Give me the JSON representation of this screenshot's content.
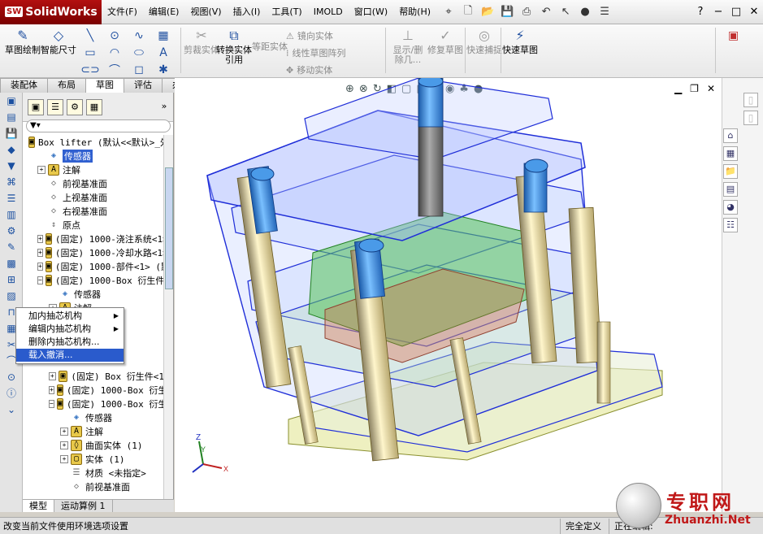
{
  "app": {
    "name": "SolidWorks",
    "logo_prefix": "SW"
  },
  "menu": [
    "文件(F)",
    "编辑(E)",
    "视图(V)",
    "插入(I)",
    "工具(T)",
    "IMOLD",
    "窗口(W)",
    "帮助(H)"
  ],
  "window_controls": {
    "help": "?",
    "minimize": "−",
    "restore": "□",
    "close": "✕"
  },
  "command_manager": {
    "sketch": "草图绘制",
    "smart_dim": "智能尺寸",
    "trim": "剪裁实体",
    "convert": "转换实体引用",
    "offset": "等距实体",
    "mirror": "镜向实体",
    "linear_pattern": "线性草图阵列",
    "move": "移动实体",
    "show_hide": "显示/删除几...",
    "repair": "修复草图",
    "snap": "快速捕捉",
    "rapid_sketch": "快速草图"
  },
  "tabs": [
    "装配体",
    "布局",
    "草图",
    "评估",
    "办公室产品"
  ],
  "active_tab": "草图",
  "tree": [
    {
      "label": "Box lifter  (默认<<默认>_外",
      "indent": 0,
      "exp": "",
      "icon": "asm"
    },
    {
      "label": "传感器",
      "indent": 1,
      "exp": "",
      "icon": "sensor",
      "selected": true
    },
    {
      "label": "注解",
      "indent": 1,
      "exp": "+",
      "icon": "A"
    },
    {
      "label": "前视基准面",
      "indent": 1,
      "exp": "",
      "icon": "plane"
    },
    {
      "label": "上视基准面",
      "indent": 1,
      "exp": "",
      "icon": "plane"
    },
    {
      "label": "右视基准面",
      "indent": 1,
      "exp": "",
      "icon": "plane"
    },
    {
      "label": "原点",
      "indent": 1,
      "exp": "",
      "icon": "origin"
    },
    {
      "label": "(固定) 1000-浇注系统<1>",
      "indent": 1,
      "exp": "+",
      "icon": "asm"
    },
    {
      "label": "(固定) 1000-冷却水路<1>",
      "indent": 1,
      "exp": "+",
      "icon": "asm"
    },
    {
      "label": "(固定) 1000-部件<1> (默",
      "indent": 1,
      "exp": "+",
      "icon": "asm"
    },
    {
      "label": "(固定) 1000-Box 衍生件_",
      "indent": 1,
      "exp": "−",
      "icon": "asm"
    },
    {
      "label": "传感器",
      "indent": 2,
      "exp": "",
      "icon": "sensor"
    },
    {
      "label": "注解",
      "indent": 2,
      "exp": "+",
      "icon": "A"
    }
  ],
  "tree_lower": [
    {
      "label": "(固定) Box 衍生件<1",
      "indent": 2,
      "exp": "+",
      "icon": "asm"
    },
    {
      "label": "(固定) 1000-Box 衍生",
      "indent": 2,
      "exp": "+",
      "icon": "asm"
    },
    {
      "label": "(固定) 1000-Box 衍生",
      "indent": 2,
      "exp": "−",
      "icon": "asm"
    },
    {
      "label": "传感器",
      "indent": 3,
      "exp": "",
      "icon": "sensor"
    },
    {
      "label": "注解",
      "indent": 3,
      "exp": "+",
      "icon": "A"
    },
    {
      "label": "曲面实体 (1)",
      "indent": 3,
      "exp": "+",
      "icon": "surf"
    },
    {
      "label": "实体 (1)",
      "indent": 3,
      "exp": "+",
      "icon": "solid"
    },
    {
      "label": "材质 <未指定>",
      "indent": 3,
      "exp": "",
      "icon": "mat"
    },
    {
      "label": "前视基准面",
      "indent": 3,
      "exp": "",
      "icon": "plane"
    }
  ],
  "context_menu": [
    {
      "label": "加内抽芯机构",
      "arrow": "▶"
    },
    {
      "label": "编辑内抽芯机构",
      "arrow": "▶"
    },
    {
      "label": "删除内抽芯机构...",
      "arrow": ""
    },
    {
      "label": "载入撤消...",
      "arrow": "",
      "highlight": true
    }
  ],
  "fm_bottom_tabs": [
    "模型",
    "运动算例 1"
  ],
  "status": {
    "message": "改变当前文件使用环境选项设置",
    "cell1": "完全定义",
    "cell2": "正在编辑:"
  },
  "watermark": {
    "cn": "专职网",
    "en": "Zhuanzhi.Net"
  },
  "axes": {
    "x": "X",
    "y": "Y",
    "z": "Z"
  },
  "colors": {
    "accent": "#2a5bcc",
    "brand": "#b31010",
    "mold_edge": "#1f2ed8"
  }
}
